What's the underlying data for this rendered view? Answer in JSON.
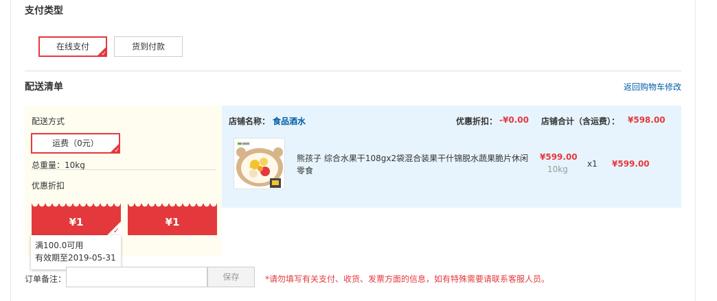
{
  "payment": {
    "title": "支付类型",
    "options": [
      {
        "label": "在线支付",
        "selected": true
      },
      {
        "label": "货到付款",
        "selected": false
      }
    ]
  },
  "delivery": {
    "title": "配送清单",
    "back_link": "返回购物车修改",
    "method_label": "配送方式",
    "shipping_option": "运费（0元）",
    "total_weight": "总重量：10kg",
    "discount_label": "优惠折扣",
    "coupons": [
      {
        "amount": "¥1",
        "selected": true
      },
      {
        "amount": "¥1",
        "selected": false
      }
    ],
    "coupon_tooltip": {
      "condition": "满100.0可用",
      "expiry": "有效期至2019-05-31"
    }
  },
  "store": {
    "name_label": "店铺名称：",
    "name": "食品酒水",
    "discount_label": "优惠折扣：",
    "discount_value": "-¥0.00",
    "total_label": "店铺合计（含运费）：",
    "total_value": "¥598.00",
    "product": {
      "title": "熊孩子 综合水果干108gx2袋混合装果干什锦脱水蔬果脆片休闲零食",
      "price": "¥599.00",
      "weight": "10kg",
      "quantity": "x1",
      "subtotal": "¥599.00"
    }
  },
  "remark": {
    "label": "订单备注：",
    "value": "",
    "save_label": "保存",
    "notice": "*请勿填写有关支付、收货、发票方面的信息，如有特殊需要请联系客服人员。"
  },
  "colors": {
    "accent_red": "#e4393c",
    "link_blue": "#005ea7",
    "store_bg": "#e7f4fd",
    "delivery_bg": "#fffdf0"
  }
}
